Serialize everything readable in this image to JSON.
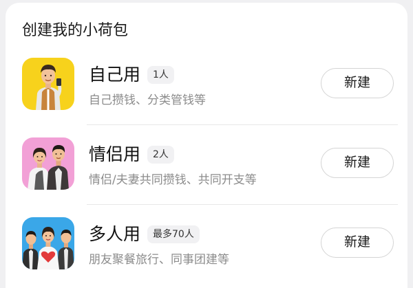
{
  "card": {
    "title": "创建我的小荷包"
  },
  "options": [
    {
      "label": "自己用",
      "badge": "1人",
      "description": "自己攒钱、分类管钱等",
      "button": "新建",
      "icon": "single-person-avatar-icon",
      "icon_bg": "#f7d21c"
    },
    {
      "label": "情侣用",
      "badge": "2人",
      "description": "情侣/夫妻共同攒钱、共同开支等",
      "button": "新建",
      "icon": "couple-avatar-icon",
      "icon_bg": "#f2a0d6"
    },
    {
      "label": "多人用",
      "badge": "最多70人",
      "description": "朋友聚餐旅行、同事团建等",
      "button": "新建",
      "icon": "group-avatar-icon",
      "icon_bg": "#3aa7e8"
    }
  ]
}
